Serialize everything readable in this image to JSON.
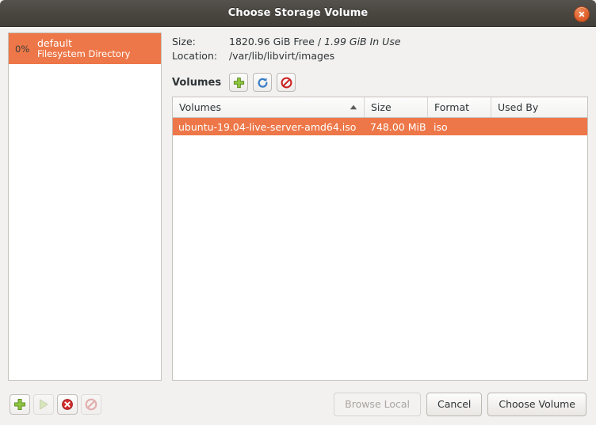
{
  "window": {
    "title": "Choose Storage Volume",
    "close_icon": "close-icon",
    "accent_color": "#ed7748",
    "titlebar_color": "#4a4640"
  },
  "pools": {
    "items": [
      {
        "percent": "0%",
        "name": "default",
        "type": "Filesystem Directory",
        "selected": true
      }
    ]
  },
  "details": {
    "size_label": "Size:",
    "size_free": "1820.96 GiB Free /",
    "size_inuse": "1.99 GiB In Use",
    "location_label": "Location:",
    "location_value": "/var/lib/libvirt/images"
  },
  "volumes_toolbar": {
    "label": "Volumes",
    "buttons": [
      {
        "name": "add-volume-button",
        "icon": "plus-icon",
        "enabled": true
      },
      {
        "name": "refresh-volumes-button",
        "icon": "refresh-icon",
        "enabled": true
      },
      {
        "name": "delete-volume-button",
        "icon": "delete-icon",
        "enabled": true
      }
    ]
  },
  "table": {
    "columns": [
      {
        "label": "Volumes",
        "sorted": "asc"
      },
      {
        "label": "Size",
        "sorted": ""
      },
      {
        "label": "Format",
        "sorted": ""
      },
      {
        "label": "Used By",
        "sorted": ""
      }
    ],
    "rows": [
      {
        "volume": "ubuntu-19.04-live-server-amd64.iso",
        "size": "748.00 MiB",
        "format": "iso",
        "used_by": "",
        "selected": true
      }
    ]
  },
  "pool_toolbar": {
    "buttons": [
      {
        "name": "add-pool-button",
        "icon": "plus-icon",
        "enabled": true
      },
      {
        "name": "start-pool-button",
        "icon": "play-icon",
        "enabled": false
      },
      {
        "name": "stop-pool-button",
        "icon": "stop-x-icon",
        "enabled": true
      },
      {
        "name": "delete-pool-button",
        "icon": "delete-icon",
        "enabled": false
      }
    ]
  },
  "dialog_buttons": {
    "browse_local": "Browse Local",
    "browse_local_enabled": false,
    "cancel": "Cancel",
    "choose_volume": "Choose Volume"
  }
}
